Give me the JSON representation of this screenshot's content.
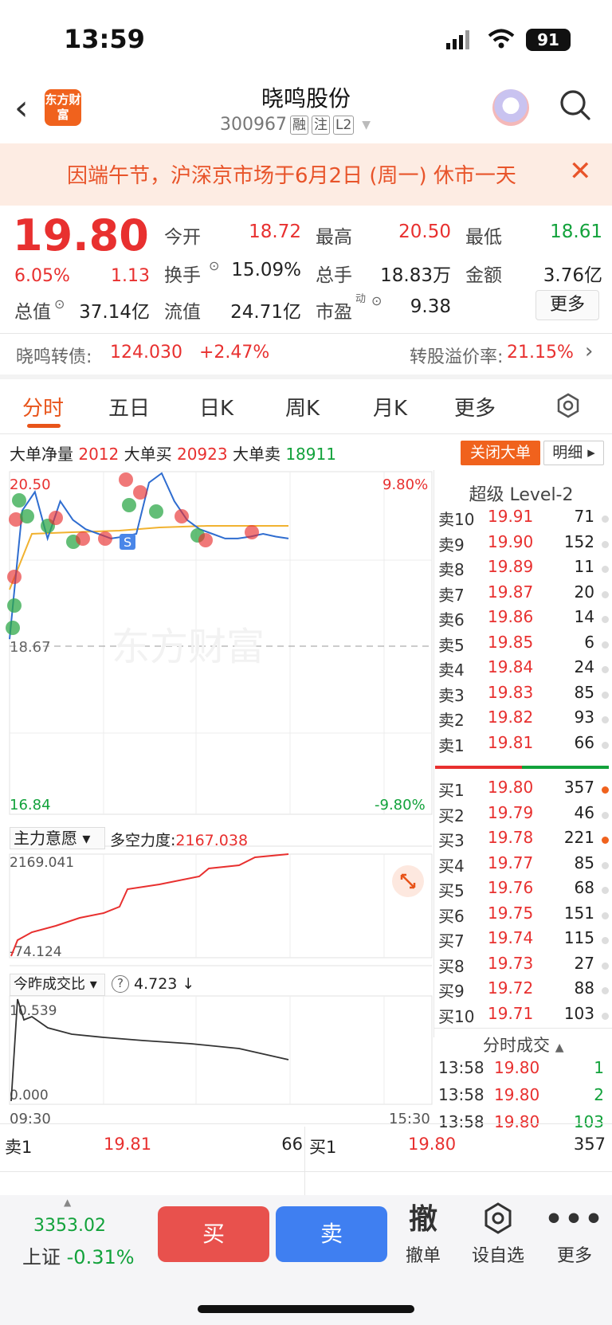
{
  "status_bar": {
    "time": "13:59",
    "battery": "91"
  },
  "header": {
    "logo_text": "东方财富",
    "stock_name": "晓鸣股份",
    "stock_code": "300967",
    "tags": [
      "融",
      "注",
      "L2"
    ]
  },
  "notice": {
    "text": "因端午节，沪深京市场于6月2日 (周一) 休市一天"
  },
  "quote": {
    "price": "19.80",
    "change_pct": "6.05%",
    "change": "1.13",
    "fields": {
      "open_label": "今开",
      "open": "18.72",
      "high_label": "最高",
      "high": "20.50",
      "low_label": "最低",
      "low": "18.61",
      "turnover_label": "换手",
      "turnover": "15.09%",
      "volume_label": "总手",
      "volume": "18.83万",
      "amount_label": "金额",
      "amount": "3.76亿",
      "mktcap_label": "总值",
      "mktcap": "37.14亿",
      "float_label": "流值",
      "float": "24.71亿",
      "pe_label": "市盈",
      "pe_super": "动",
      "pe": "9.38"
    },
    "more": "更多"
  },
  "convertible": {
    "label": "晓鸣转债:",
    "price": "124.030",
    "change": "+2.47%",
    "premium_label": "转股溢价率:",
    "premium": "21.15%"
  },
  "tabs": [
    "分时",
    "五日",
    "日K",
    "周K",
    "月K",
    "更多"
  ],
  "big_order": {
    "net_label": "大单净量",
    "net": "2012",
    "buy_label": "大单买",
    "buy": "20923",
    "sell_label": "大单卖",
    "sell": "18911",
    "close_btn": "关闭大单",
    "detail_btn": "明细"
  },
  "chart": {
    "y_high": "20.50",
    "y_mid": "18.67",
    "y_low": "16.84",
    "pct_high": "9.80%",
    "pct_low": "-9.80%",
    "watermark": "东方财富",
    "s_marker": "S",
    "indicator1_label": "主力意愿",
    "indicator1_name": "多空力度:",
    "indicator1_value": "2167.038",
    "indicator1_max": "2169.041",
    "indicator1_min": "-74.124",
    "indicator2_label": "今昨成交比",
    "indicator2_value": "4.723 ↓",
    "indicator2_max": "10.539",
    "indicator2_min": "0.000",
    "time_start": "09:30",
    "time_end": "15:30"
  },
  "chart_data": {
    "type": "line",
    "title": "",
    "y_range": [
      16.84,
      20.5
    ],
    "baseline": 18.67,
    "series": [
      {
        "name": "",
        "values": [
          18.72,
          20.1,
          20.3,
          19.8,
          20.2,
          20.0,
          19.9,
          19.85,
          19.8,
          19.82,
          19.85,
          20.4,
          20.5,
          20.2,
          20.0,
          19.9,
          19.85,
          19.8,
          19.8,
          19.82,
          19.85,
          19.82,
          19.8
        ]
      }
    ]
  },
  "order_book": {
    "title": "超级 Level-2",
    "asks": [
      {
        "label": "卖10",
        "price": "19.91",
        "vol": "71"
      },
      {
        "label": "卖9",
        "price": "19.90",
        "vol": "152"
      },
      {
        "label": "卖8",
        "price": "19.89",
        "vol": "11"
      },
      {
        "label": "卖7",
        "price": "19.87",
        "vol": "20"
      },
      {
        "label": "卖6",
        "price": "19.86",
        "vol": "14"
      },
      {
        "label": "卖5",
        "price": "19.85",
        "vol": "6"
      },
      {
        "label": "卖4",
        "price": "19.84",
        "vol": "24"
      },
      {
        "label": "卖3",
        "price": "19.83",
        "vol": "85"
      },
      {
        "label": "卖2",
        "price": "19.82",
        "vol": "93"
      },
      {
        "label": "卖1",
        "price": "19.81",
        "vol": "66"
      }
    ],
    "bids": [
      {
        "label": "买1",
        "price": "19.80",
        "vol": "357"
      },
      {
        "label": "买2",
        "price": "19.79",
        "vol": "46"
      },
      {
        "label": "买3",
        "price": "19.78",
        "vol": "221"
      },
      {
        "label": "买4",
        "price": "19.77",
        "vol": "85"
      },
      {
        "label": "买5",
        "price": "19.76",
        "vol": "68"
      },
      {
        "label": "买6",
        "price": "19.75",
        "vol": "151"
      },
      {
        "label": "买7",
        "price": "19.74",
        "vol": "115"
      },
      {
        "label": "买8",
        "price": "19.73",
        "vol": "27"
      },
      {
        "label": "买9",
        "price": "19.72",
        "vol": "88"
      },
      {
        "label": "买10",
        "price": "19.71",
        "vol": "103"
      }
    ],
    "ticks_title": "分时成交",
    "ticks": [
      {
        "time": "13:58",
        "price": "19.80",
        "vol": "1"
      },
      {
        "time": "13:58",
        "price": "19.80",
        "vol": "2"
      },
      {
        "time": "13:58",
        "price": "19.80",
        "vol": "103"
      }
    ]
  },
  "level1": {
    "sell_label": "卖1",
    "sell_price": "19.81",
    "sell_vol": "66",
    "buy_label": "买1",
    "buy_price": "19.80",
    "buy_vol": "357"
  },
  "bottom_bar": {
    "index_value": "3353.02",
    "index_name": "上证",
    "index_change": "-0.31%",
    "buy": "买",
    "sell": "卖",
    "cancel_icon": "撤",
    "cancel": "撤单",
    "watchlist": "设自选",
    "more": "更多"
  }
}
